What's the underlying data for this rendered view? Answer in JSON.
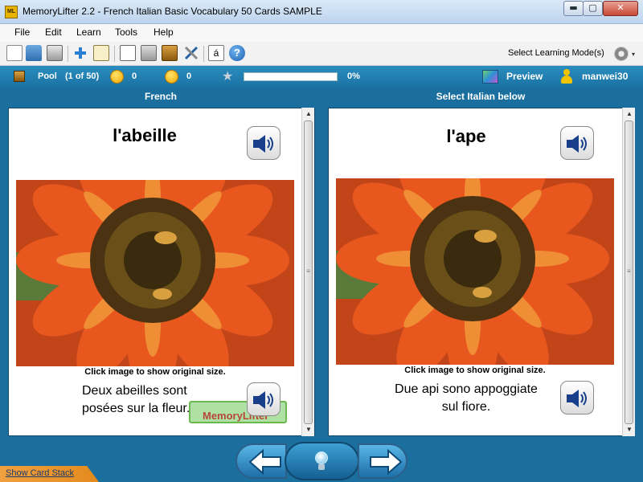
{
  "window": {
    "title": "MemoryLifter 2.2 - French Italian Basic Vocabulary 50 Cards SAMPLE",
    "app_icon_text": "ML",
    "min_glyph": "▬",
    "max_glyph": "▢",
    "close_glyph": "✕"
  },
  "menu": {
    "items": [
      "File",
      "Edit",
      "Learn",
      "Tools",
      "Help"
    ]
  },
  "toolbar": {
    "icons": [
      "new-file-icon",
      "open-folder-icon",
      "print-icon",
      "add-icon",
      "edit-card-icon",
      "presentation-icon",
      "card-settings-icon",
      "stack-icon",
      "tools-icon",
      "accent-character-icon",
      "help-icon"
    ],
    "accent_glyph": "á",
    "help_glyph": "?",
    "mode_label": "Select Learning Mode(s)",
    "mode_arrow": "▾"
  },
  "status": {
    "pool_label": "Pool",
    "pool_count": "(1 of 50)",
    "correct_count": "0",
    "wrong_count": "0",
    "progress_percent_text": "0%",
    "progress_fraction": 0,
    "preview_label": "Preview",
    "username": "manwei30"
  },
  "question": {
    "header": "French",
    "word": "l'abeille",
    "caption": "Click image to show original size.",
    "sentence_line1": "Deux abeilles sont",
    "sentence_line2": "posées sur la fleur."
  },
  "answer": {
    "header": "Select Italian below",
    "word": "l'ape",
    "caption": "Click image to show original size.",
    "sentence_line1": "Due api sono appoggiate",
    "sentence_line2": "sul fiore."
  },
  "watermark": "MemoryLifter",
  "scroll": {
    "up_glyph": "▲",
    "down_glyph": "▼",
    "grip_glyph": "≡"
  },
  "nav": {
    "hint_icon": "light-bulb-icon"
  },
  "footer": {
    "card_stack_link": "Show Card Stack"
  },
  "colors": {
    "status_bar": "#1b73a3",
    "panel_background": "#1a6f9f",
    "nav_buttons": "#1d6fa8"
  }
}
